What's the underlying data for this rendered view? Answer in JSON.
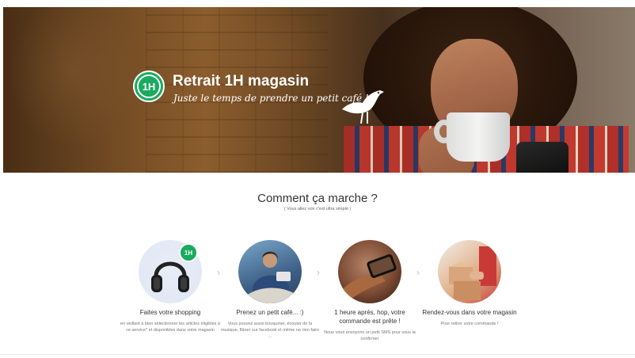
{
  "hero": {
    "badge_text": "1H",
    "title": "Retrait 1H magasin",
    "tagline": "Juste le temps de prendre un petit café !",
    "brand_color": "#1aab5e",
    "logo_icon": "auchan-bird-icon"
  },
  "how_it_works": {
    "title": "Comment ça marche ?",
    "subtitle": "( Vous allez voir c'est ultra simple )",
    "steps": [
      {
        "image": "headphones-image",
        "title": "Faites votre shopping",
        "description": "en veillant à bien sélectionner les articles éligibles à ce service* et disponibles dans votre magasin",
        "badge": "1H"
      },
      {
        "image": "woman-relaxing-image",
        "title": "Prenez un petit café... :)",
        "description": "Vous pouvez aussi bouquiner, écouter de la musique, flâner sur facebook et même ne rien faire ..."
      },
      {
        "image": "hand-with-phone-image",
        "title": "1 heure après, hop, votre commande est prête !",
        "description": "Nous vous envoyons un petit SMS pour vous la confirmer"
      },
      {
        "image": "delivery-boxes-image",
        "title": "Rendez-vous dans votre magasin",
        "description": "Pour retirer votre commande !"
      }
    ],
    "arrow_glyph": "›"
  }
}
